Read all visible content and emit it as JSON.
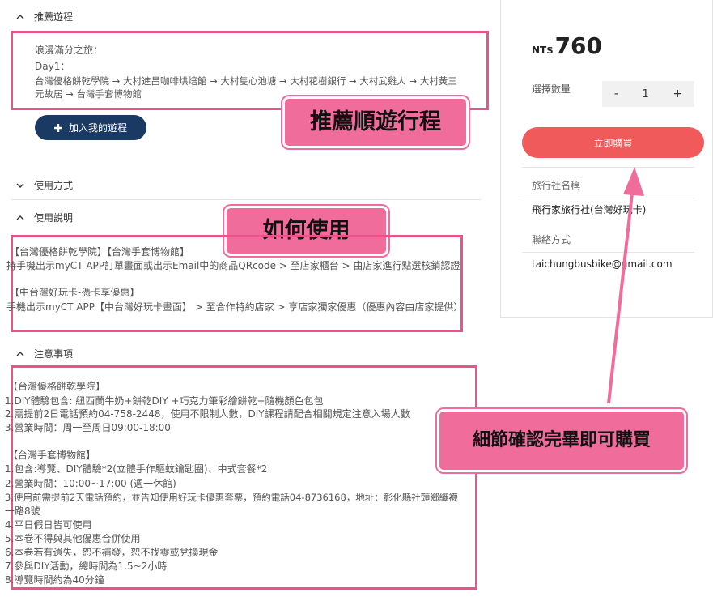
{
  "sections": {
    "recommended": {
      "title": "推薦遊程"
    },
    "usage": {
      "title": "使用方式"
    },
    "instructions": {
      "title": "使用說明"
    },
    "notes": {
      "title": "注意事項"
    }
  },
  "itinerary": {
    "name": "浪漫滿分之旅：",
    "day": "Day1：",
    "route_line1": "台灣優格餅乾學院 → 大村進昌咖啡烘焙館 → 大村隻心池塘 → 大村花樹銀行 → 大村武雞人 → 大村黃三",
    "route_line2": "元故居 → 台灣手套博物館",
    "add_button": "加入我的遊程"
  },
  "instructions_text": {
    "line1": "【台灣優格餅乾學院】【台灣手套博物館】",
    "line2": "持手機出示myCT APP訂單畫面或出示Email中的商品QRcode > 至店家櫃台 > 由店家進行點選核銷認證",
    "line3": "【中台灣好玩卡-憑卡享優惠】",
    "line4": "手機出示myCT APP【中台灣好玩卡畫面】 > 至合作特約店家 > 享店家獨家優惠（優惠內容由店家提供）"
  },
  "notes_text": {
    "l1": "【台灣優格餅乾學院】",
    "l2": "1.DIY體驗包含: 紐西蘭牛奶+餅乾DIY +巧克力筆彩繪餅乾+隨機顏色包包",
    "l3": "2.需提前2日電話預約04-758-2448，使用不限制人數，DIY課程請配合相關規定注意入場人數",
    "l4": "3.營業時間：周一至周日09:00-18:00",
    "l5": "【台灣手套博物館】",
    "l6": "1.包含:導覽、DIY體驗*2(立體手作驅蚊鑰匙圈)、中式套餐*2",
    "l7": "2.營業時間：10:00~17:00 (週一休館)",
    "l8": "3.使用前需提前2天電話預約，並告知使用好玩卡優惠套票，預約電話04-8736168，地址：彰化縣社頭鄉織襪",
    "l9": "一路8號",
    "l10": "4.平日假日皆可使用",
    "l11": "5.本卷不得與其他優惠合併使用",
    "l12": "6.本卷若有遺失，恕不補發，恕不找零或兌換現金",
    "l13": "7.參與DIY活動，總時間為1.5~2小時",
    "l14": "8.導覽時間約為40分鐘"
  },
  "purchase": {
    "currency": "NT$",
    "price": "760",
    "qty_label": "選擇數量",
    "minus": "-",
    "qty": "1",
    "plus": "+",
    "buy_button": "立即購買",
    "agency_label": "旅行社名稱",
    "agency_name": "飛行家旅行社(台灣好玩卡)",
    "contact_label": "聯絡方式",
    "contact_email": "taichungbusbike@gmail.com"
  },
  "callouts": {
    "c1": "推薦順遊行程",
    "c2": "如何使用",
    "c3": "細節確認完畢即可購買"
  },
  "colors": {
    "highlight_border": "#e8538a",
    "callout_bg": "#f06c9b",
    "navy_button": "#1b3a63",
    "buy_button": "#f05a5a"
  }
}
